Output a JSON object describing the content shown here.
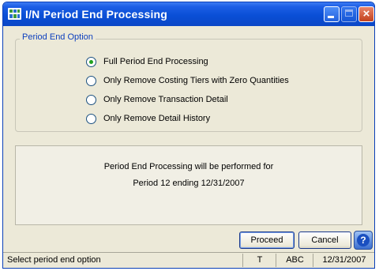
{
  "window": {
    "title": "I/N Period End Processing",
    "close_glyph": "×"
  },
  "period_end_option": {
    "legend": "Period End Option",
    "options": [
      {
        "label": "Full Period End Processing",
        "selected": true
      },
      {
        "label": "Only Remove Costing Tiers with Zero Quantities",
        "selected": false
      },
      {
        "label": "Only Remove Transaction Detail",
        "selected": false
      },
      {
        "label": "Only Remove Detail History",
        "selected": false
      }
    ]
  },
  "info": {
    "line1": "Period End Processing will be performed for",
    "line2": "Period 12 ending  12/31/2007"
  },
  "buttons": {
    "proceed": "Proceed",
    "cancel": "Cancel",
    "help": "?"
  },
  "status": {
    "message": "Select period end option",
    "indicator": "T",
    "company": "ABC",
    "date": "12/31/2007"
  },
  "icons": {
    "app": "grid-app-icon",
    "help": "help-icon"
  },
  "colors": {
    "titlebar": "#0a4fd6",
    "legend": "#0c3fbe",
    "radio_selected": "#21a121",
    "close_button": "#c3421e"
  }
}
